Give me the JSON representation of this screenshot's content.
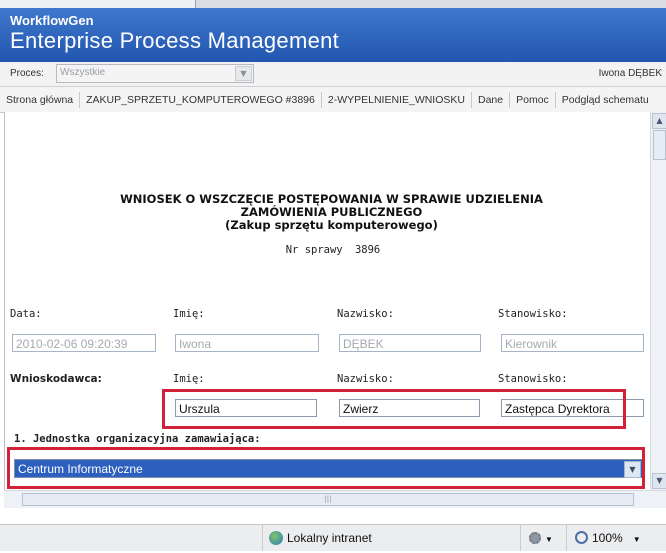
{
  "header": {
    "brand": "WorkflowGen",
    "title": "Enterprise Process Management"
  },
  "subbar": {
    "process_label": "Proces:",
    "process_value": "Wszystkie",
    "user": "Iwona DĘBEK"
  },
  "menu": {
    "items": [
      "Strona główna",
      "ZAKUP_SPRZETU_KOMPUTEROWEGO #3896",
      "2-WYPELNIENIE_WNIOSKU",
      "Dane",
      "Pomoc",
      "Podgląd schematu"
    ]
  },
  "form": {
    "title_lines": [
      "WNIOSEK O WSZCZĘCIE POSTĘPOWANIA W SPRAWIE UDZIELENIA",
      "ZAMÓWIENIA PUBLICZNEGO",
      "(Zakup sprzętu komputerowego)"
    ],
    "case_label": "Nr sprawy",
    "case_number": "3896",
    "labels": {
      "date": "Data:",
      "first_name": "Imię:",
      "last_name": "Nazwisko:",
      "position": "Stanowisko:",
      "applicant": "Wnioskodawca:",
      "unit": "1. Jednostka organizacyjna zamawiająca:"
    },
    "row1": {
      "date": "2010-02-06 09:20:39",
      "first_name": "Iwona",
      "last_name": "DĘBEK",
      "position": "Kierownik"
    },
    "applicant_row": {
      "first_name": "Urszula",
      "last_name": "Zwierz",
      "position": "Zastępca Dyrektora"
    },
    "unit_value": "Centrum Informatyczne"
  },
  "status": {
    "zone": "Lokalny intranet",
    "zoom": "100%"
  },
  "colors": {
    "header_blue": "#2a5db4",
    "highlight_red": "#d2223a",
    "select_blue": "#2d5fbe"
  }
}
